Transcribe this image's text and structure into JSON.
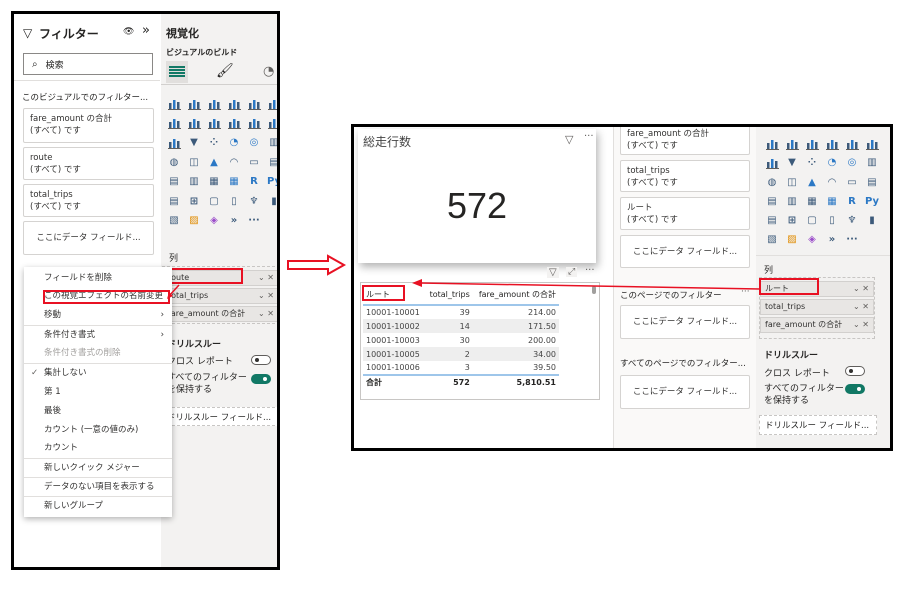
{
  "left": {
    "filters": {
      "title": "フィルター",
      "search_placeholder": "検索",
      "section_visual": "このビジュアルでのフィルター...",
      "cards": [
        {
          "field": "fare_amount の合計",
          "state": "(すべて) です"
        },
        {
          "field": "route",
          "state": "(すべて) です"
        },
        {
          "field": "total_trips",
          "state": "(すべて) です"
        }
      ],
      "drop_placeholder": "ここにデータ フィールド..."
    },
    "viz": {
      "title": "視覚化",
      "build_label": "ビジュアルのビルド",
      "columns_label": "列",
      "wells": [
        "route",
        "total_trips",
        "fare_amount の合計"
      ],
      "drill_title": "ドリルスルー",
      "cross_report": "クロス レポート",
      "cross_report_on": false,
      "keep_filters_1": "すべてのフィルター",
      "keep_filters_2": "を保持する",
      "keep_filters_on": true,
      "drill_placeholder": "ドリルスルー フィールド..."
    },
    "context_menu": {
      "items": [
        "フィールドを削除",
        "この視覚エフェクトの名前変更",
        "移動",
        "条件付き書式",
        "条件付き書式の削除",
        "集計しない",
        "第 1",
        "最後",
        "カウント (一意の値のみ)",
        "カウント",
        "新しいクイック メジャー",
        "データのない項目を表示する",
        "新しいグループ"
      ],
      "checked": "集計しない"
    }
  },
  "right": {
    "card_visual": {
      "title": "総走行数",
      "value": "572"
    },
    "table": {
      "headers": [
        "ルート",
        "total_trips",
        "fare_amount の合計"
      ],
      "rows": [
        [
          "10001-10001",
          "39",
          "214.00"
        ],
        [
          "10001-10002",
          "14",
          "171.50"
        ],
        [
          "10001-10003",
          "30",
          "200.00"
        ],
        [
          "10001-10005",
          "2",
          "34.00"
        ],
        [
          "10001-10006",
          "3",
          "39.50"
        ]
      ],
      "total": [
        "合計",
        "572",
        "5,810.51"
      ]
    },
    "filters": {
      "cards": [
        {
          "field": "fare_amount の合計",
          "state": "(すべて) です"
        },
        {
          "field": "total_trips",
          "state": "(すべて) です"
        },
        {
          "field": "ルート",
          "state": "(すべて) です"
        }
      ],
      "drop_placeholder": "ここにデータ フィールド...",
      "page_section": "このページでのフィルター",
      "all_pages_section": "すべてのページでのフィルター..."
    },
    "viz": {
      "columns_label": "列",
      "wells": [
        "ルート",
        "total_trips",
        "fare_amount の合計"
      ],
      "drill_title": "ドリルスルー",
      "cross_report": "クロス レポート",
      "keep_filters_1": "すべてのフィルター",
      "keep_filters_2": "を保持する",
      "drill_placeholder": "ドリルスルー フィールド..."
    }
  },
  "icons": [
    "stacked-bar",
    "stacked-column",
    "clustered-bar",
    "clustered-column",
    "100-bar",
    "100-column",
    "line",
    "area",
    "stacked-area",
    "line-column",
    "line-cluster",
    "ribbon",
    "waterfall",
    "funnel",
    "scatter",
    "pie",
    "donut",
    "treemap",
    "map",
    "filled-map",
    "azure-map",
    "gauge",
    "card",
    "multirow-card",
    "kpi",
    "slicer",
    "table",
    "matrix",
    "r-visual",
    "python-visual",
    "key-influencers",
    "decomposition-tree",
    "qa",
    "smart-narrative",
    "goals",
    "paginated",
    "power-apps",
    "power-automate",
    "diamond",
    "chevrons",
    "more"
  ],
  "colors": {
    "accent": "#117865",
    "red": "#e81123",
    "blue_rule": "#9ec6ea"
  }
}
